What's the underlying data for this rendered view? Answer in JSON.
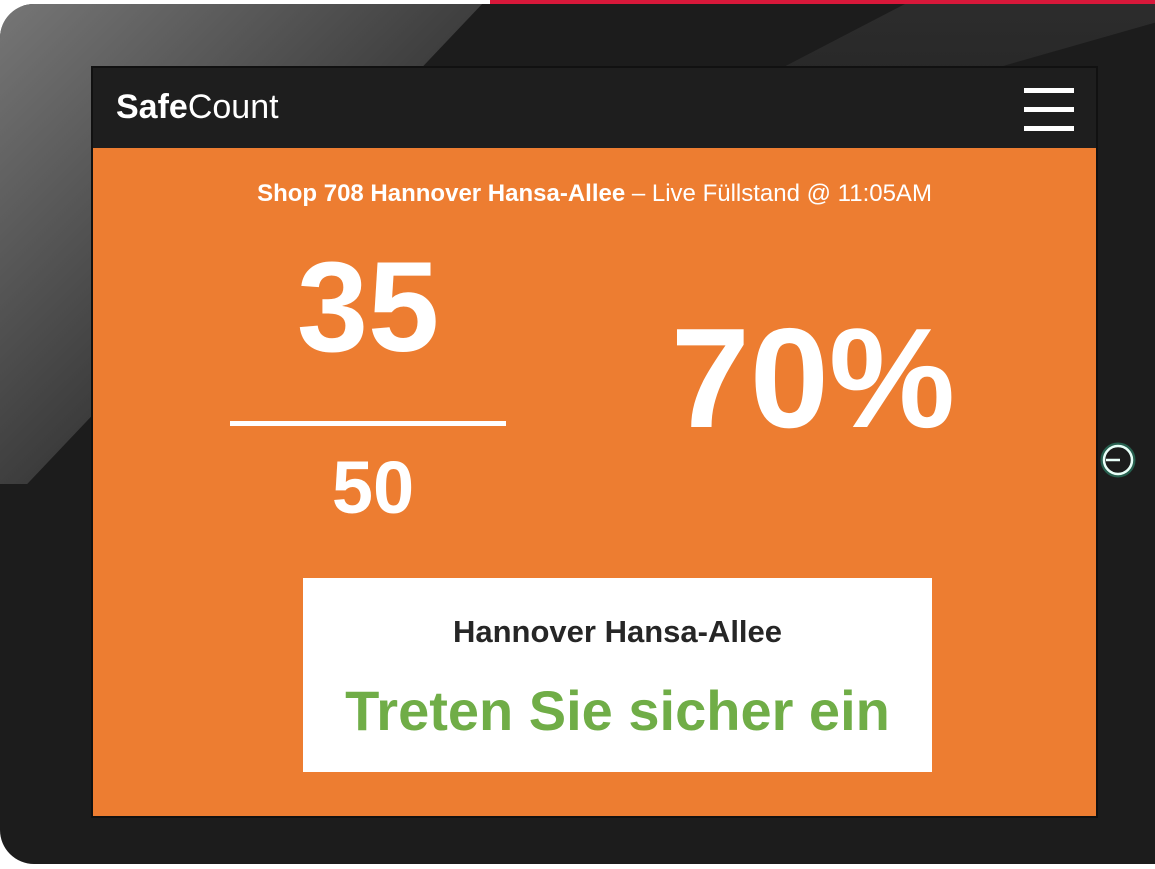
{
  "app": {
    "brand_bold": "Safe",
    "brand_light": "Count"
  },
  "status": {
    "shop_name": "Shop 708 Hannover Hansa-Allee",
    "separator": " – ",
    "live_label": "Live Füllstand @ 11:05AM",
    "current_count": "35",
    "capacity": "50",
    "occupancy_percent": "70%"
  },
  "card": {
    "location": "Hannover Hansa-Allee",
    "message": "Treten Sie sicher ein"
  },
  "icons": {
    "menu": "hamburger-menu-icon",
    "power": "power-icon"
  },
  "colors": {
    "screen_background": "#ed7d31",
    "header_background": "#1e1e1e",
    "message_green": "#70ad47",
    "accent_red": "#d8183a",
    "power_glow": "#3be0b0"
  }
}
